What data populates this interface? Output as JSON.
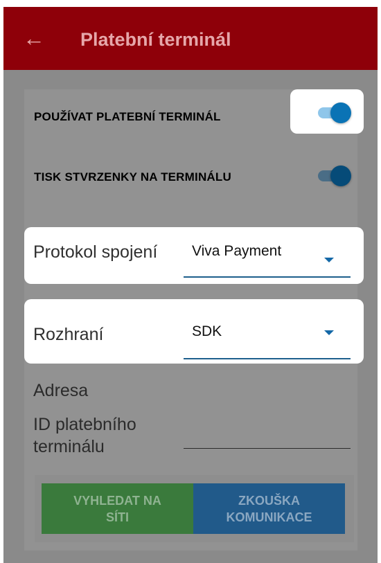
{
  "appbar": {
    "title": "Platební terminál",
    "back_icon": "arrow-left-icon"
  },
  "settings": {
    "use_terminal": {
      "label": "POUŽÍVAT PLATEBNÍ TERMINÁL",
      "on": true
    },
    "print_receipt": {
      "label": "TISK STVRZENKY NA TERMINÁLU",
      "on": true
    }
  },
  "fields": {
    "protocol": {
      "label": "Protokol spojení",
      "value": "Viva Payment"
    },
    "interface": {
      "label": "Rozhraní",
      "value": "SDK"
    },
    "address": {
      "label": "Adresa"
    },
    "terminal_id": {
      "label_line1": "ID platebního",
      "label_line2": "terminálu",
      "value": ""
    }
  },
  "buttons": {
    "search_line1": "VYHLEDAT NA",
    "search_line2": "SÍTI",
    "test_line1": "ZKOUŠKA",
    "test_line2": "KOMUNIKACE"
  },
  "colors": {
    "appbar": "#8e0009",
    "accent": "#0a73b5",
    "search_button": "#3a7a3c",
    "test_button": "#215a8a"
  }
}
